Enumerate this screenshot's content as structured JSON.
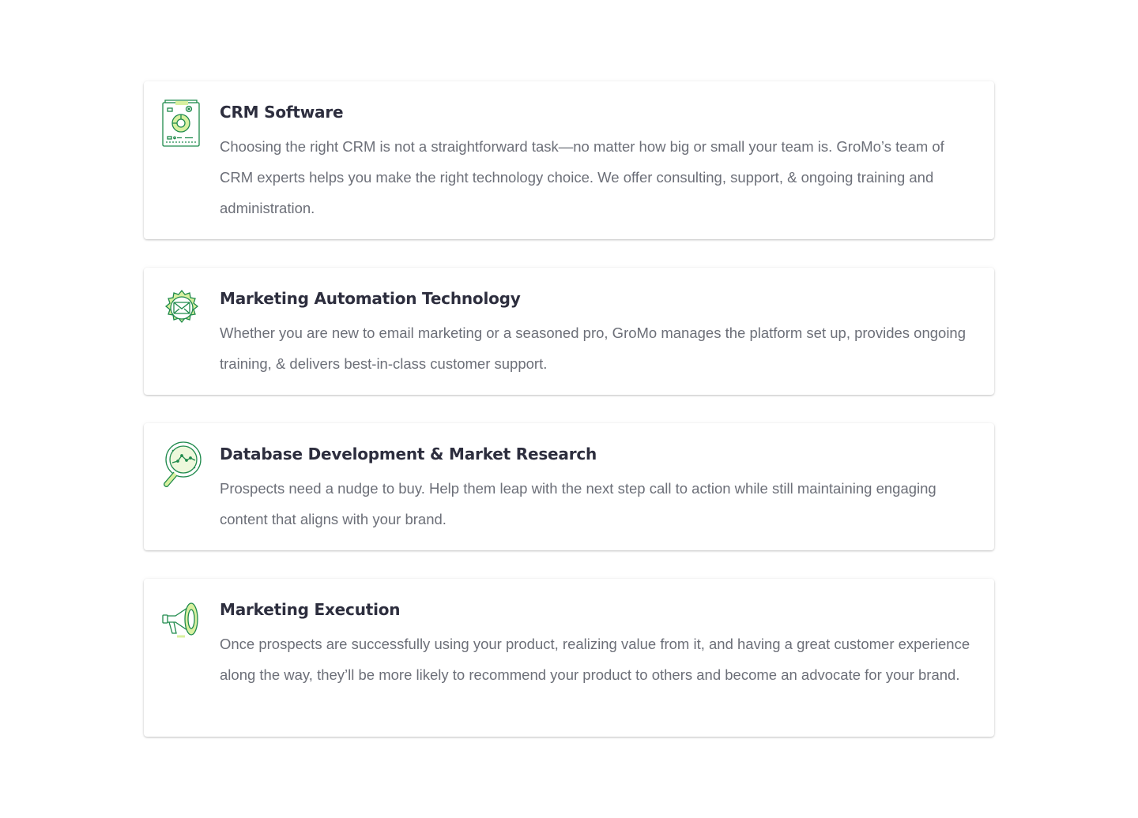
{
  "services": [
    {
      "icon": "crm-report-icon",
      "title": "CRM Software",
      "description": "Choosing the right CRM is not a straightforward task—no matter how big or small your team is. GroMo’s team of CRM experts helps you make the right technology choice. We offer consulting, support, & ongoing training and administration."
    },
    {
      "icon": "email-gear-icon",
      "title": "Marketing Automation Technology",
      "description": "Whether you are new to email marketing or a seasoned pro, GroMo manages the platform set up, provides ongoing training, & delivers best-in-class customer support."
    },
    {
      "icon": "magnifier-chart-icon",
      "title": "Database Development & Market Research",
      "description": "Prospects need a nudge to buy. Help them leap with the next step call to action while still maintaining engaging content that aligns with your brand."
    },
    {
      "icon": "megaphone-icon",
      "title": "Marketing Execution",
      "description": "Once prospects are successfully using your product, realizing value from it, and having a great customer experience along the way, they’ll be more likely to recommend your product to others and become an advocate for your brand."
    }
  ],
  "colors": {
    "icon_stroke": "#1f8a4c",
    "icon_accent": "#d8f0a0",
    "title": "#2d2e3e",
    "text": "#6c6f78"
  }
}
